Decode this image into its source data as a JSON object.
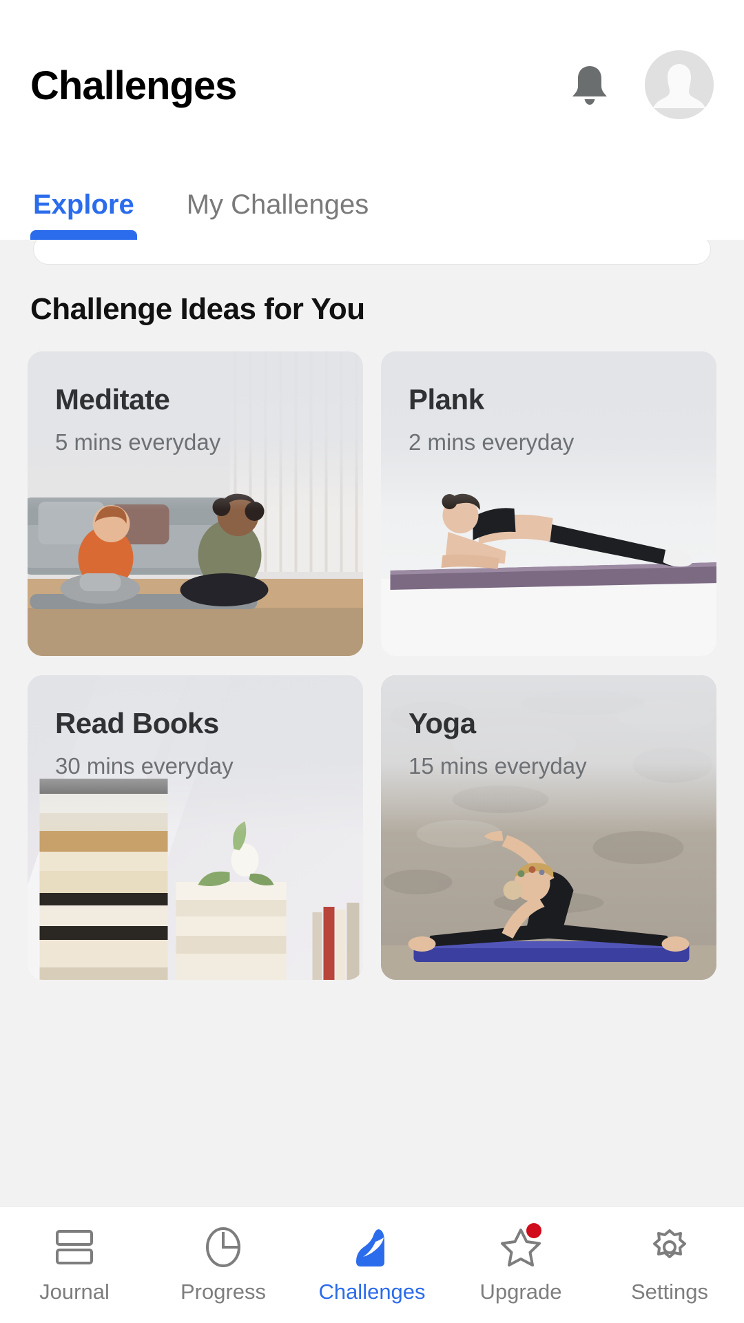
{
  "header": {
    "title": "Challenges",
    "notification_icon": "bell-icon",
    "avatar_icon": "person-avatar-placeholder"
  },
  "tabs": [
    {
      "label": "Explore",
      "active": true
    },
    {
      "label": "My Challenges",
      "active": false
    }
  ],
  "main": {
    "section_title": "Challenge Ideas for You",
    "cards": [
      {
        "title": "Meditate",
        "subtitle": "5 mins everyday",
        "image": "two-women-meditating-on-floor-by-sofa"
      },
      {
        "title": "Plank",
        "subtitle": "2 mins everyday",
        "image": "woman-in-plank-pose-on-yoga-mat"
      },
      {
        "title": "Read Books",
        "subtitle": "30 mins everyday",
        "image": "stacks-of-books-in-sunlight"
      },
      {
        "title": "Yoga",
        "subtitle": "15 mins everyday",
        "image": "woman-doing-side-stretch-yoga-on-blue-mat"
      }
    ]
  },
  "bottom_nav": [
    {
      "label": "Journal",
      "icon": "journal-icon",
      "active": false,
      "badge": false
    },
    {
      "label": "Progress",
      "icon": "pie-chart-icon",
      "active": false,
      "badge": false
    },
    {
      "label": "Challenges",
      "icon": "mountain-icon",
      "active": true,
      "badge": false
    },
    {
      "label": "Upgrade",
      "icon": "star-icon",
      "active": false,
      "badge": true
    },
    {
      "label": "Settings",
      "icon": "gear-icon",
      "active": false,
      "badge": false
    }
  ],
  "colors": {
    "accent": "#2b6cec",
    "badge": "#d00c1c",
    "inactive": "#7d7d7d",
    "background": "#f2f2f2",
    "surface": "#ffffff"
  }
}
